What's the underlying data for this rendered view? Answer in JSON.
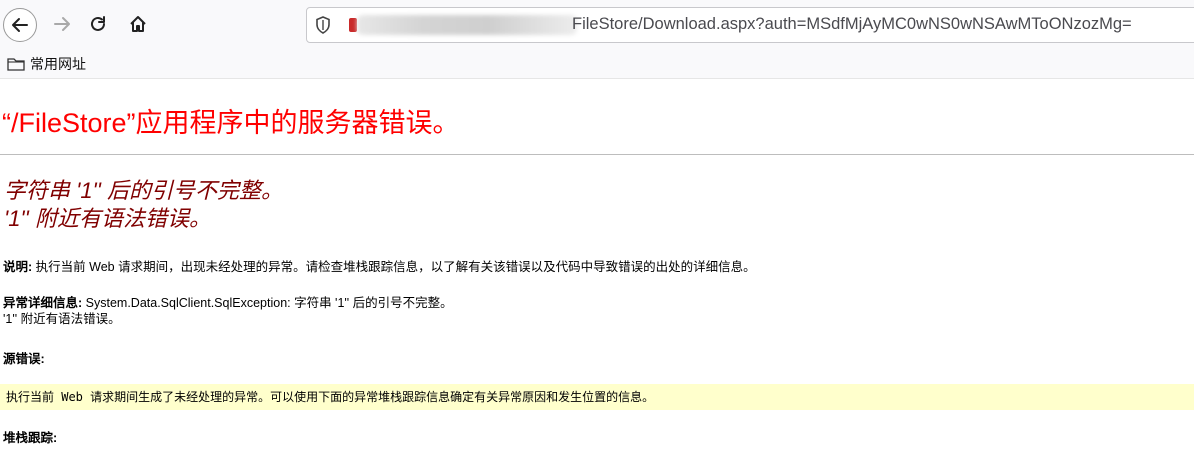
{
  "browser": {
    "url": "FileStore/Download.aspx?auth=MSdfMjAyMC0wNS0wNSAwMToONzozMg=",
    "icons": [
      "back-icon",
      "forward-icon",
      "reload-icon",
      "home-icon",
      "shield-icon"
    ]
  },
  "bookmarks": {
    "item_label": "常用网址"
  },
  "page": {
    "title": "“/FileStore”应用程序中的服务器错误。",
    "error_line1": "字符串 '1'' 后的引号不完整。",
    "error_line2": "'1'' 附近有语法错误。",
    "description_label": "说明:",
    "description_text": "执行当前 Web 请求期间，出现未经处理的异常。请检查堆栈跟踪信息，以了解有关该错误以及代码中导致错误的出处的详细信息。",
    "exception_label": "异常详细信息:",
    "exception_text": "System.Data.SqlClient.SqlException: 字符串 '1'' 后的引号不完整。",
    "exception_line2": "'1'' 附近有语法错误。",
    "source_error_label": "源错误:",
    "source_error_box": "执行当前 Web 请求期间生成了未经处理的异常。可以使用下面的异常堆栈跟踪信息确定有关异常原因和发生位置的信息。",
    "stack_trace_label": "堆栈跟踪:"
  },
  "colors": {
    "title_red": "#ff0000",
    "subtitle_maroon": "#800000",
    "code_bg": "#ffffcc"
  }
}
